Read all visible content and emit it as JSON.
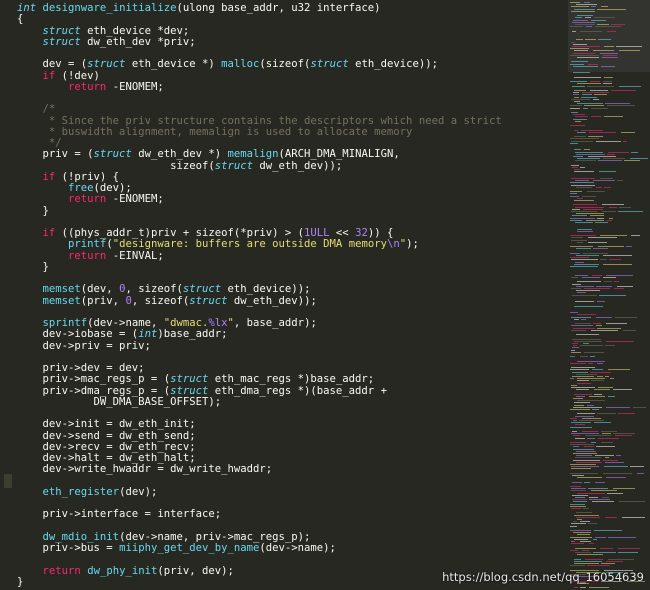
{
  "colors": {
    "background": "#272822",
    "text": "#f8f8f2",
    "keyword": "#f92672",
    "type": "#66d9ef",
    "function": "#66d9ef",
    "number": "#ae81ff",
    "string": "#e6db74",
    "comment": "#75715e"
  },
  "editor": {
    "lines": [
      [
        [
          "type",
          "int"
        ],
        [
          "plain",
          " "
        ],
        [
          "fn",
          "designware_initialize"
        ],
        [
          "plain",
          "(ulong base_addr, u32 interface)"
        ]
      ],
      [
        [
          "plain",
          "{"
        ]
      ],
      [
        [
          "plain",
          "    "
        ],
        [
          "type",
          "struct"
        ],
        [
          "plain",
          " eth_device *dev;"
        ]
      ],
      [
        [
          "plain",
          "    "
        ],
        [
          "type",
          "struct"
        ],
        [
          "plain",
          " dw_eth_dev *priv;"
        ]
      ],
      [
        [
          "plain",
          ""
        ]
      ],
      [
        [
          "plain",
          "    dev = ("
        ],
        [
          "type",
          "struct"
        ],
        [
          "plain",
          " eth_device *) "
        ],
        [
          "fn",
          "malloc"
        ],
        [
          "plain",
          "(sizeof("
        ],
        [
          "type",
          "struct"
        ],
        [
          "plain",
          " eth_device));"
        ]
      ],
      [
        [
          "plain",
          "    "
        ],
        [
          "kw",
          "if"
        ],
        [
          "plain",
          " (!dev)"
        ]
      ],
      [
        [
          "plain",
          "        "
        ],
        [
          "kw",
          "return"
        ],
        [
          "plain",
          " -ENOMEM;"
        ]
      ],
      [
        [
          "plain",
          ""
        ]
      ],
      [
        [
          "plain",
          "    "
        ],
        [
          "cm",
          "/*"
        ]
      ],
      [
        [
          "plain",
          "    "
        ],
        [
          "cm",
          " * Since the priv structure contains the descriptors which need a strict"
        ]
      ],
      [
        [
          "plain",
          "    "
        ],
        [
          "cm",
          " * buswidth alignment, memalign is used to allocate memory"
        ]
      ],
      [
        [
          "plain",
          "    "
        ],
        [
          "cm",
          " */"
        ]
      ],
      [
        [
          "plain",
          "    priv = ("
        ],
        [
          "type",
          "struct"
        ],
        [
          "plain",
          " dw_eth_dev *) "
        ],
        [
          "fn",
          "memalign"
        ],
        [
          "plain",
          "(ARCH_DMA_MINALIGN,"
        ]
      ],
      [
        [
          "plain",
          "                        sizeof("
        ],
        [
          "type",
          "struct"
        ],
        [
          "plain",
          " dw_eth_dev));"
        ]
      ],
      [
        [
          "plain",
          "    "
        ],
        [
          "kw",
          "if"
        ],
        [
          "plain",
          " (!priv) {"
        ]
      ],
      [
        [
          "plain",
          "        "
        ],
        [
          "fn",
          "free"
        ],
        [
          "plain",
          "(dev);"
        ]
      ],
      [
        [
          "plain",
          "        "
        ],
        [
          "kw",
          "return"
        ],
        [
          "plain",
          " -ENOMEM;"
        ]
      ],
      [
        [
          "plain",
          "    }"
        ]
      ],
      [
        [
          "plain",
          ""
        ]
      ],
      [
        [
          "plain",
          "    "
        ],
        [
          "kw",
          "if"
        ],
        [
          "plain",
          " ((phys_addr_t)priv + sizeof(*priv) > ("
        ],
        [
          "num",
          "1ULL"
        ],
        [
          "plain",
          " << "
        ],
        [
          "num",
          "32"
        ],
        [
          "plain",
          ")) {"
        ]
      ],
      [
        [
          "plain",
          "        "
        ],
        [
          "fn",
          "printf"
        ],
        [
          "plain",
          "("
        ],
        [
          "str",
          "\"designware: buffers are outside DMA memory"
        ],
        [
          "num",
          "\\n"
        ],
        [
          "str",
          "\""
        ],
        [
          "plain",
          ");"
        ]
      ],
      [
        [
          "plain",
          "        "
        ],
        [
          "kw",
          "return"
        ],
        [
          "plain",
          " -EINVAL;"
        ]
      ],
      [
        [
          "plain",
          "    }"
        ]
      ],
      [
        [
          "plain",
          ""
        ]
      ],
      [
        [
          "plain",
          "    "
        ],
        [
          "fn",
          "memset"
        ],
        [
          "plain",
          "(dev, "
        ],
        [
          "num",
          "0"
        ],
        [
          "plain",
          ", sizeof("
        ],
        [
          "type",
          "struct"
        ],
        [
          "plain",
          " eth_device));"
        ]
      ],
      [
        [
          "plain",
          "    "
        ],
        [
          "fn",
          "memset"
        ],
        [
          "plain",
          "(priv, "
        ],
        [
          "num",
          "0"
        ],
        [
          "plain",
          ", sizeof("
        ],
        [
          "type",
          "struct"
        ],
        [
          "plain",
          " dw_eth_dev));"
        ]
      ],
      [
        [
          "plain",
          ""
        ]
      ],
      [
        [
          "plain",
          "    "
        ],
        [
          "fn",
          "sprintf"
        ],
        [
          "plain",
          "(dev->name, "
        ],
        [
          "str",
          "\"dwmac."
        ],
        [
          "num",
          "%lx"
        ],
        [
          "str",
          "\""
        ],
        [
          "plain",
          ", base_addr);"
        ]
      ],
      [
        [
          "plain",
          "    dev->iobase = ("
        ],
        [
          "type",
          "int"
        ],
        [
          "plain",
          ")base_addr;"
        ]
      ],
      [
        [
          "plain",
          "    dev->priv = priv;"
        ]
      ],
      [
        [
          "plain",
          ""
        ]
      ],
      [
        [
          "plain",
          "    priv->dev = dev;"
        ]
      ],
      [
        [
          "plain",
          "    priv->mac_regs_p = ("
        ],
        [
          "type",
          "struct"
        ],
        [
          "plain",
          " eth_mac_regs *)base_addr;"
        ]
      ],
      [
        [
          "plain",
          "    priv->dma_regs_p = ("
        ],
        [
          "type",
          "struct"
        ],
        [
          "plain",
          " eth_dma_regs *)(base_addr +"
        ]
      ],
      [
        [
          "plain",
          "            DW_DMA_BASE_OFFSET);"
        ]
      ],
      [
        [
          "plain",
          ""
        ]
      ],
      [
        [
          "plain",
          "    dev->init = dw_eth_init;"
        ]
      ],
      [
        [
          "plain",
          "    dev->send = dw_eth_send;"
        ]
      ],
      [
        [
          "plain",
          "    dev->recv = dw_eth_recv;"
        ]
      ],
      [
        [
          "plain",
          "    dev->halt = dw_eth_halt;"
        ]
      ],
      [
        [
          "plain",
          "    dev->write_hwaddr = dw_write_hwaddr;"
        ]
      ],
      [
        [
          "plain",
          ""
        ]
      ],
      [
        [
          "plain",
          "    "
        ],
        [
          "fn",
          "eth_register"
        ],
        [
          "plain",
          "(dev);"
        ]
      ],
      [
        [
          "plain",
          ""
        ]
      ],
      [
        [
          "plain",
          "    priv->interface = interface;"
        ]
      ],
      [
        [
          "plain",
          ""
        ]
      ],
      [
        [
          "plain",
          "    "
        ],
        [
          "fn",
          "dw_mdio_init"
        ],
        [
          "plain",
          "(dev->name, priv->mac_regs_p);"
        ]
      ],
      [
        [
          "plain",
          "    priv->bus = "
        ],
        [
          "fn",
          "miiphy_get_dev_by_name"
        ],
        [
          "plain",
          "(dev->name);"
        ]
      ],
      [
        [
          "plain",
          ""
        ]
      ],
      [
        [
          "plain",
          "    "
        ],
        [
          "kw",
          "return"
        ],
        [
          "plain",
          " "
        ],
        [
          "fn",
          "dw_phy_init"
        ],
        [
          "plain",
          "(priv, dev);"
        ]
      ],
      [
        [
          "plain",
          "}"
        ]
      ]
    ]
  },
  "watermark": {
    "text": "https://blog.csdn.net/qq_16054639"
  }
}
